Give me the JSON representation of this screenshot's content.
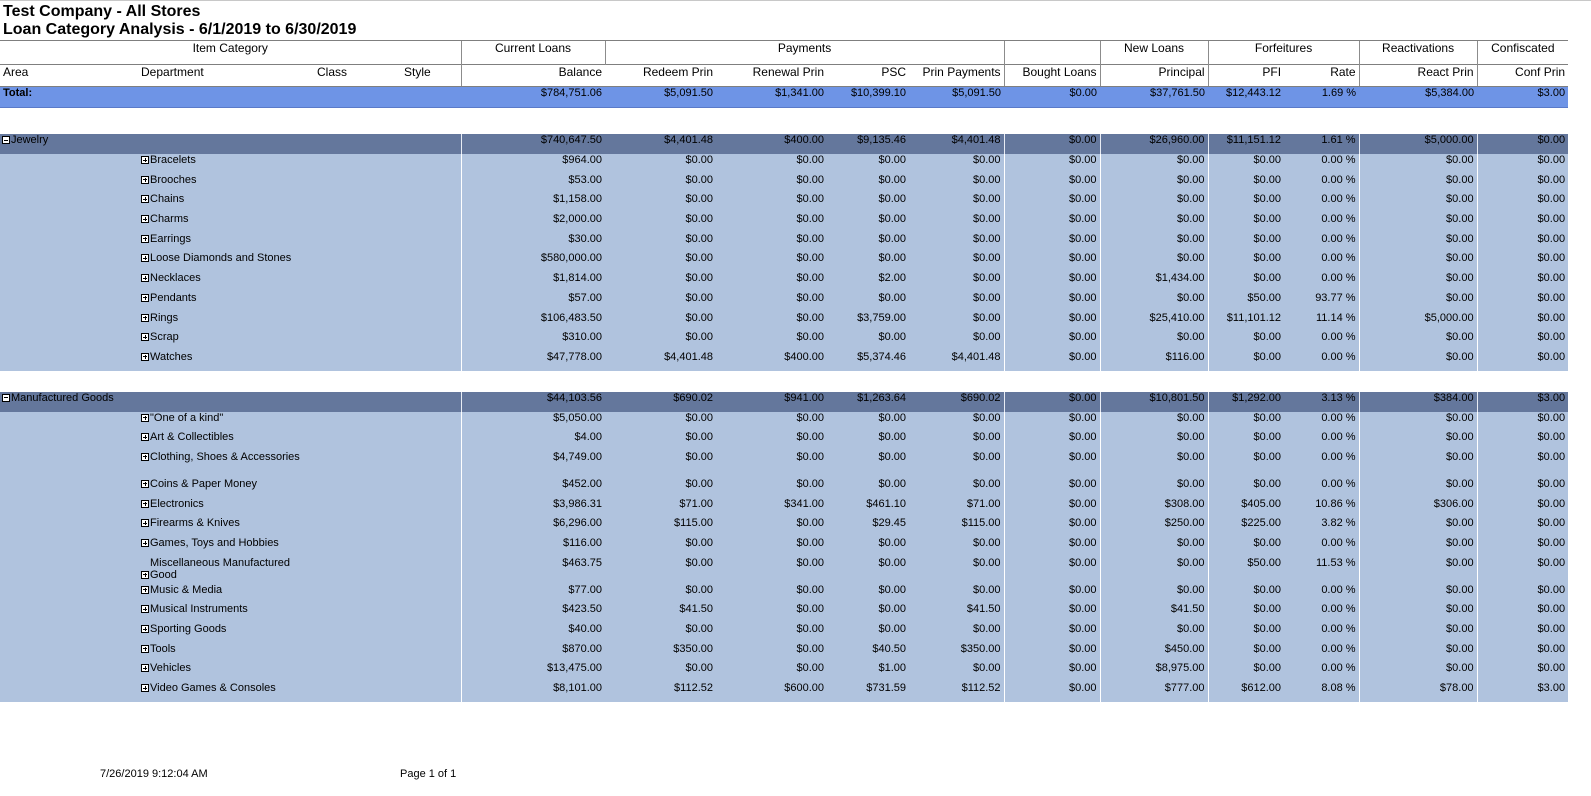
{
  "report": {
    "title": "Test Company - All Stores",
    "subtitle": "Loan Category Analysis - 6/1/2019 to 6/30/2019"
  },
  "group_headers": [
    "Item Category",
    "Current Loans",
    "Payments",
    "",
    "New Loans",
    "Forfeitures",
    "Reactivations",
    "Confiscated"
  ],
  "columns": {
    "area": "Area",
    "department": "Department",
    "class": "Class",
    "style": "Style",
    "balance": "Balance",
    "redeem": "Redeem Prin",
    "renewal": "Renewal Prin",
    "psc": "PSC",
    "prin_payments": "Prin Payments",
    "bought": "Bought Loans",
    "principal": "Principal",
    "pfi": "PFI",
    "rate": "Rate",
    "react": "React Prin",
    "conf": "Conf Prin"
  },
  "total": {
    "label": "Total:",
    "values": [
      "$784,751.06",
      "$5,091.50",
      "$1,341.00",
      "$10,399.10",
      "$5,091.50",
      "$0.00",
      "$37,761.50",
      "$12,443.12",
      "1.69 %",
      "$5,384.00",
      "$3.00"
    ]
  },
  "areas": [
    {
      "name": "Jewelry",
      "values": [
        "$740,647.50",
        "$4,401.48",
        "$400.00",
        "$9,135.46",
        "$4,401.48",
        "$0.00",
        "$26,960.00",
        "$11,151.12",
        "1.61 %",
        "$5,000.00",
        "$0.00"
      ],
      "rows": [
        {
          "name": "Bracelets",
          "values": [
            "$964.00",
            "$0.00",
            "$0.00",
            "$0.00",
            "$0.00",
            "$0.00",
            "$0.00",
            "$0.00",
            "0.00 %",
            "$0.00",
            "$0.00"
          ]
        },
        {
          "name": "Brooches",
          "values": [
            "$53.00",
            "$0.00",
            "$0.00",
            "$0.00",
            "$0.00",
            "$0.00",
            "$0.00",
            "$0.00",
            "0.00 %",
            "$0.00",
            "$0.00"
          ]
        },
        {
          "name": "Chains",
          "values": [
            "$1,158.00",
            "$0.00",
            "$0.00",
            "$0.00",
            "$0.00",
            "$0.00",
            "$0.00",
            "$0.00",
            "0.00 %",
            "$0.00",
            "$0.00"
          ]
        },
        {
          "name": "Charms",
          "values": [
            "$2,000.00",
            "$0.00",
            "$0.00",
            "$0.00",
            "$0.00",
            "$0.00",
            "$0.00",
            "$0.00",
            "0.00 %",
            "$0.00",
            "$0.00"
          ]
        },
        {
          "name": "Earrings",
          "values": [
            "$30.00",
            "$0.00",
            "$0.00",
            "$0.00",
            "$0.00",
            "$0.00",
            "$0.00",
            "$0.00",
            "0.00 %",
            "$0.00",
            "$0.00"
          ]
        },
        {
          "name": "Loose Diamonds and Stones",
          "values": [
            "$580,000.00",
            "$0.00",
            "$0.00",
            "$0.00",
            "$0.00",
            "$0.00",
            "$0.00",
            "$0.00",
            "0.00 %",
            "$0.00",
            "$0.00"
          ]
        },
        {
          "name": "Necklaces",
          "values": [
            "$1,814.00",
            "$0.00",
            "$0.00",
            "$2.00",
            "$0.00",
            "$0.00",
            "$1,434.00",
            "$0.00",
            "0.00 %",
            "$0.00",
            "$0.00"
          ]
        },
        {
          "name": "Pendants",
          "values": [
            "$57.00",
            "$0.00",
            "$0.00",
            "$0.00",
            "$0.00",
            "$0.00",
            "$0.00",
            "$50.00",
            "93.77 %",
            "$0.00",
            "$0.00"
          ]
        },
        {
          "name": "Rings",
          "values": [
            "$106,483.50",
            "$0.00",
            "$0.00",
            "$3,759.00",
            "$0.00",
            "$0.00",
            "$25,410.00",
            "$11,101.12",
            "11.14 %",
            "$5,000.00",
            "$0.00"
          ]
        },
        {
          "name": "Scrap",
          "values": [
            "$310.00",
            "$0.00",
            "$0.00",
            "$0.00",
            "$0.00",
            "$0.00",
            "$0.00",
            "$0.00",
            "0.00 %",
            "$0.00",
            "$0.00"
          ]
        },
        {
          "name": "Watches",
          "values": [
            "$47,778.00",
            "$4,401.48",
            "$400.00",
            "$5,374.46",
            "$4,401.48",
            "$0.00",
            "$116.00",
            "$0.00",
            "0.00 %",
            "$0.00",
            "$0.00"
          ]
        }
      ]
    },
    {
      "name": "Manufactured Goods",
      "values": [
        "$44,103.56",
        "$690.02",
        "$941.00",
        "$1,263.64",
        "$690.02",
        "$0.00",
        "$10,801.50",
        "$1,292.00",
        "3.13 %",
        "$384.00",
        "$3.00"
      ],
      "rows": [
        {
          "name": "\"One of a kind\"",
          "values": [
            "$5,050.00",
            "$0.00",
            "$0.00",
            "$0.00",
            "$0.00",
            "$0.00",
            "$0.00",
            "$0.00",
            "0.00 %",
            "$0.00",
            "$0.00"
          ]
        },
        {
          "name": "Art & Collectibles",
          "values": [
            "$4.00",
            "$0.00",
            "$0.00",
            "$0.00",
            "$0.00",
            "$0.00",
            "$0.00",
            "$0.00",
            "0.00 %",
            "$0.00",
            "$0.00"
          ]
        },
        {
          "name": "Clothing, Shoes & Accessories",
          "values": [
            "$4,749.00",
            "$0.00",
            "$0.00",
            "$0.00",
            "$0.00",
            "$0.00",
            "$0.00",
            "$0.00",
            "0.00 %",
            "$0.00",
            "$0.00"
          ]
        },
        {
          "name": "Coins & Paper Money",
          "values": [
            "$452.00",
            "$0.00",
            "$0.00",
            "$0.00",
            "$0.00",
            "$0.00",
            "$0.00",
            "$0.00",
            "0.00 %",
            "$0.00",
            "$0.00"
          ]
        },
        {
          "name": "Electronics",
          "values": [
            "$3,986.31",
            "$71.00",
            "$341.00",
            "$461.10",
            "$71.00",
            "$0.00",
            "$308.00",
            "$405.00",
            "10.86 %",
            "$306.00",
            "$0.00"
          ]
        },
        {
          "name": "Firearms & Knives",
          "values": [
            "$6,296.00",
            "$115.00",
            "$0.00",
            "$29.45",
            "$115.00",
            "$0.00",
            "$250.00",
            "$225.00",
            "3.82 %",
            "$0.00",
            "$0.00"
          ]
        },
        {
          "name": "Games, Toys and Hobbies",
          "values": [
            "$116.00",
            "$0.00",
            "$0.00",
            "$0.00",
            "$0.00",
            "$0.00",
            "$0.00",
            "$0.00",
            "0.00 %",
            "$0.00",
            "$0.00"
          ]
        },
        {
          "name": "Miscellaneous Manufactured Good",
          "values": [
            "$463.75",
            "$0.00",
            "$0.00",
            "$0.00",
            "$0.00",
            "$0.00",
            "$0.00",
            "$50.00",
            "11.53 %",
            "$0.00",
            "$0.00"
          ]
        },
        {
          "name": "Music & Media",
          "values": [
            "$77.00",
            "$0.00",
            "$0.00",
            "$0.00",
            "$0.00",
            "$0.00",
            "$0.00",
            "$0.00",
            "0.00 %",
            "$0.00",
            "$0.00"
          ]
        },
        {
          "name": "Musical Instruments",
          "values": [
            "$423.50",
            "$41.50",
            "$0.00",
            "$0.00",
            "$41.50",
            "$0.00",
            "$41.50",
            "$0.00",
            "0.00 %",
            "$0.00",
            "$0.00"
          ]
        },
        {
          "name": "Sporting Goods",
          "values": [
            "$40.00",
            "$0.00",
            "$0.00",
            "$0.00",
            "$0.00",
            "$0.00",
            "$0.00",
            "$0.00",
            "0.00 %",
            "$0.00",
            "$0.00"
          ]
        },
        {
          "name": "Tools",
          "values": [
            "$870.00",
            "$350.00",
            "$0.00",
            "$40.50",
            "$350.00",
            "$0.00",
            "$450.00",
            "$0.00",
            "0.00 %",
            "$0.00",
            "$0.00"
          ]
        },
        {
          "name": "Vehicles",
          "values": [
            "$13,475.00",
            "$0.00",
            "$0.00",
            "$1.00",
            "$0.00",
            "$0.00",
            "$8,975.00",
            "$0.00",
            "0.00 %",
            "$0.00",
            "$0.00"
          ]
        },
        {
          "name": "Video Games & Consoles",
          "values": [
            "$8,101.00",
            "$112.52",
            "$600.00",
            "$731.59",
            "$112.52",
            "$0.00",
            "$777.00",
            "$612.00",
            "8.08 %",
            "$78.00",
            "$3.00"
          ]
        }
      ]
    }
  ],
  "footer": {
    "printed": "7/26/2019 9:12:04 AM",
    "page": "Page 1 of 1"
  }
}
